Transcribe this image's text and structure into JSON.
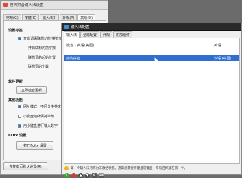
{
  "back_window": {
    "title": "搜狗拼音输入法设置",
    "tabs": [
      "常规(G)",
      "按键(K)",
      "输入法(I)",
      "外观(P)",
      "高级(D)"
    ],
    "sections": {
      "input_method_title": "设置标签",
      "web_update_title": "软件更新",
      "other_title": "其他功能",
      "fcitx_title": "Fcitx 设置"
    },
    "options": [
      {
        "label": "开启词语联想功能(拼音输入)",
        "checked": true
      },
      {
        "label": "开启联想的前字数",
        "checked": false
      },
      {
        "label": "联想词的起始位置",
        "checked": false
      },
      {
        "label": "联想词的个数",
        "checked": false
      }
    ],
    "update_button": "立即检查更新",
    "other_options": [
      {
        "label": "网址模式：不区分中英文",
        "checked": true
      },
      {
        "label": "小键盘始终保持半角",
        "checked": false
      },
      {
        "label": "用小键盘进行输入数字",
        "checked": true
      }
    ],
    "fcitx_button": "打开Fcitx 设置",
    "restore_button": "恢复本页默认设置(R)"
  },
  "front_window": {
    "title": "输入法配置",
    "tabs": [
      "输入法",
      "全局配置",
      "外观",
      "附加组件"
    ],
    "columns": {
      "name": "键盘 - 英语(美国)",
      "language": "英语"
    },
    "rows": [
      {
        "name": "搜狗拼音",
        "language": "汉语 (中国)",
        "selected": true
      }
    ],
    "hint": "第一个输入法将作为非激活状态。通常您需要将键盘或键盘 - 布局名称放在第一个。",
    "toolbar": {
      "add": "+",
      "remove": "−",
      "up": "▲",
      "down": "▼",
      "config": "⚙",
      "keyboard": "⌨"
    }
  }
}
